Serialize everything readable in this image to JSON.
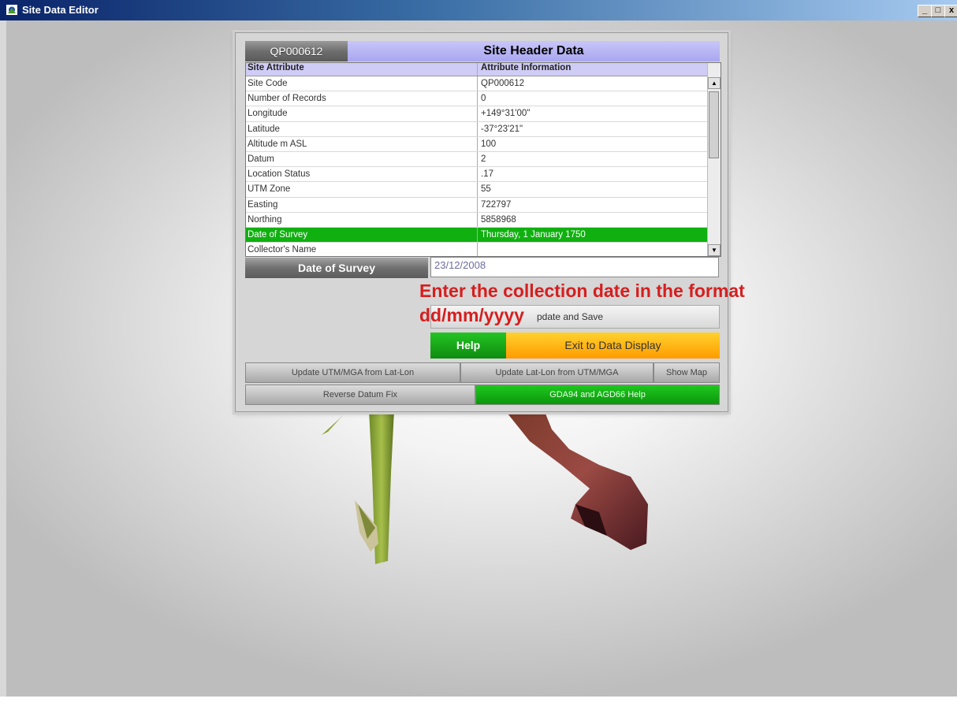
{
  "window": {
    "title": "Site Data Editor",
    "minimize": "_",
    "maximize": "□",
    "close": "x"
  },
  "header": {
    "site_code": "QP000612",
    "title": "Site Header Data"
  },
  "table": {
    "columns": [
      "Site Attribute",
      "Attribute Information"
    ],
    "rows": [
      {
        "attribute": "Site Code",
        "value": "QP000612"
      },
      {
        "attribute": "Number of Records",
        "value": "0"
      },
      {
        "attribute": "Longitude",
        "value": "+149°31'00\""
      },
      {
        "attribute": "Latitude",
        "value": "-37°23'21\""
      },
      {
        "attribute": "Altitude m ASL",
        "value": "100"
      },
      {
        "attribute": "Datum",
        "value": "2"
      },
      {
        "attribute": "Location Status",
        "value": ".17"
      },
      {
        "attribute": "UTM Zone",
        "value": "55"
      },
      {
        "attribute": "Easting",
        "value": "722797"
      },
      {
        "attribute": "Northing",
        "value": "5858968"
      },
      {
        "attribute": "Date of Survey",
        "value": "Thursday, 1 January 1750",
        "selected": true
      },
      {
        "attribute": "Collector's Name",
        "value": ""
      }
    ],
    "scroll_up": "▲",
    "scroll_down": "▼"
  },
  "editor": {
    "field_label": "Date of Survey",
    "field_value": "23/12/2008",
    "update_label": "pdate and Save",
    "help_label": "Help",
    "exit_label": "Exit to Data Display"
  },
  "annotation": {
    "line1": "Enter the collection date in the format",
    "line2": "dd/mm/yyyy"
  },
  "buttons_row1": [
    "Update UTM/MGA from Lat-Lon",
    "Update Lat-Lon from UTM/MGA",
    "Show Map"
  ],
  "buttons_row2": [
    "Reverse Datum Fix",
    "GDA94 and AGD66 Help"
  ],
  "colors": {
    "selected_row": "#10b010",
    "help": "#14a814",
    "exit": "#ffb000",
    "annotation": "#d61e1e",
    "header": "#b8b6f4"
  }
}
